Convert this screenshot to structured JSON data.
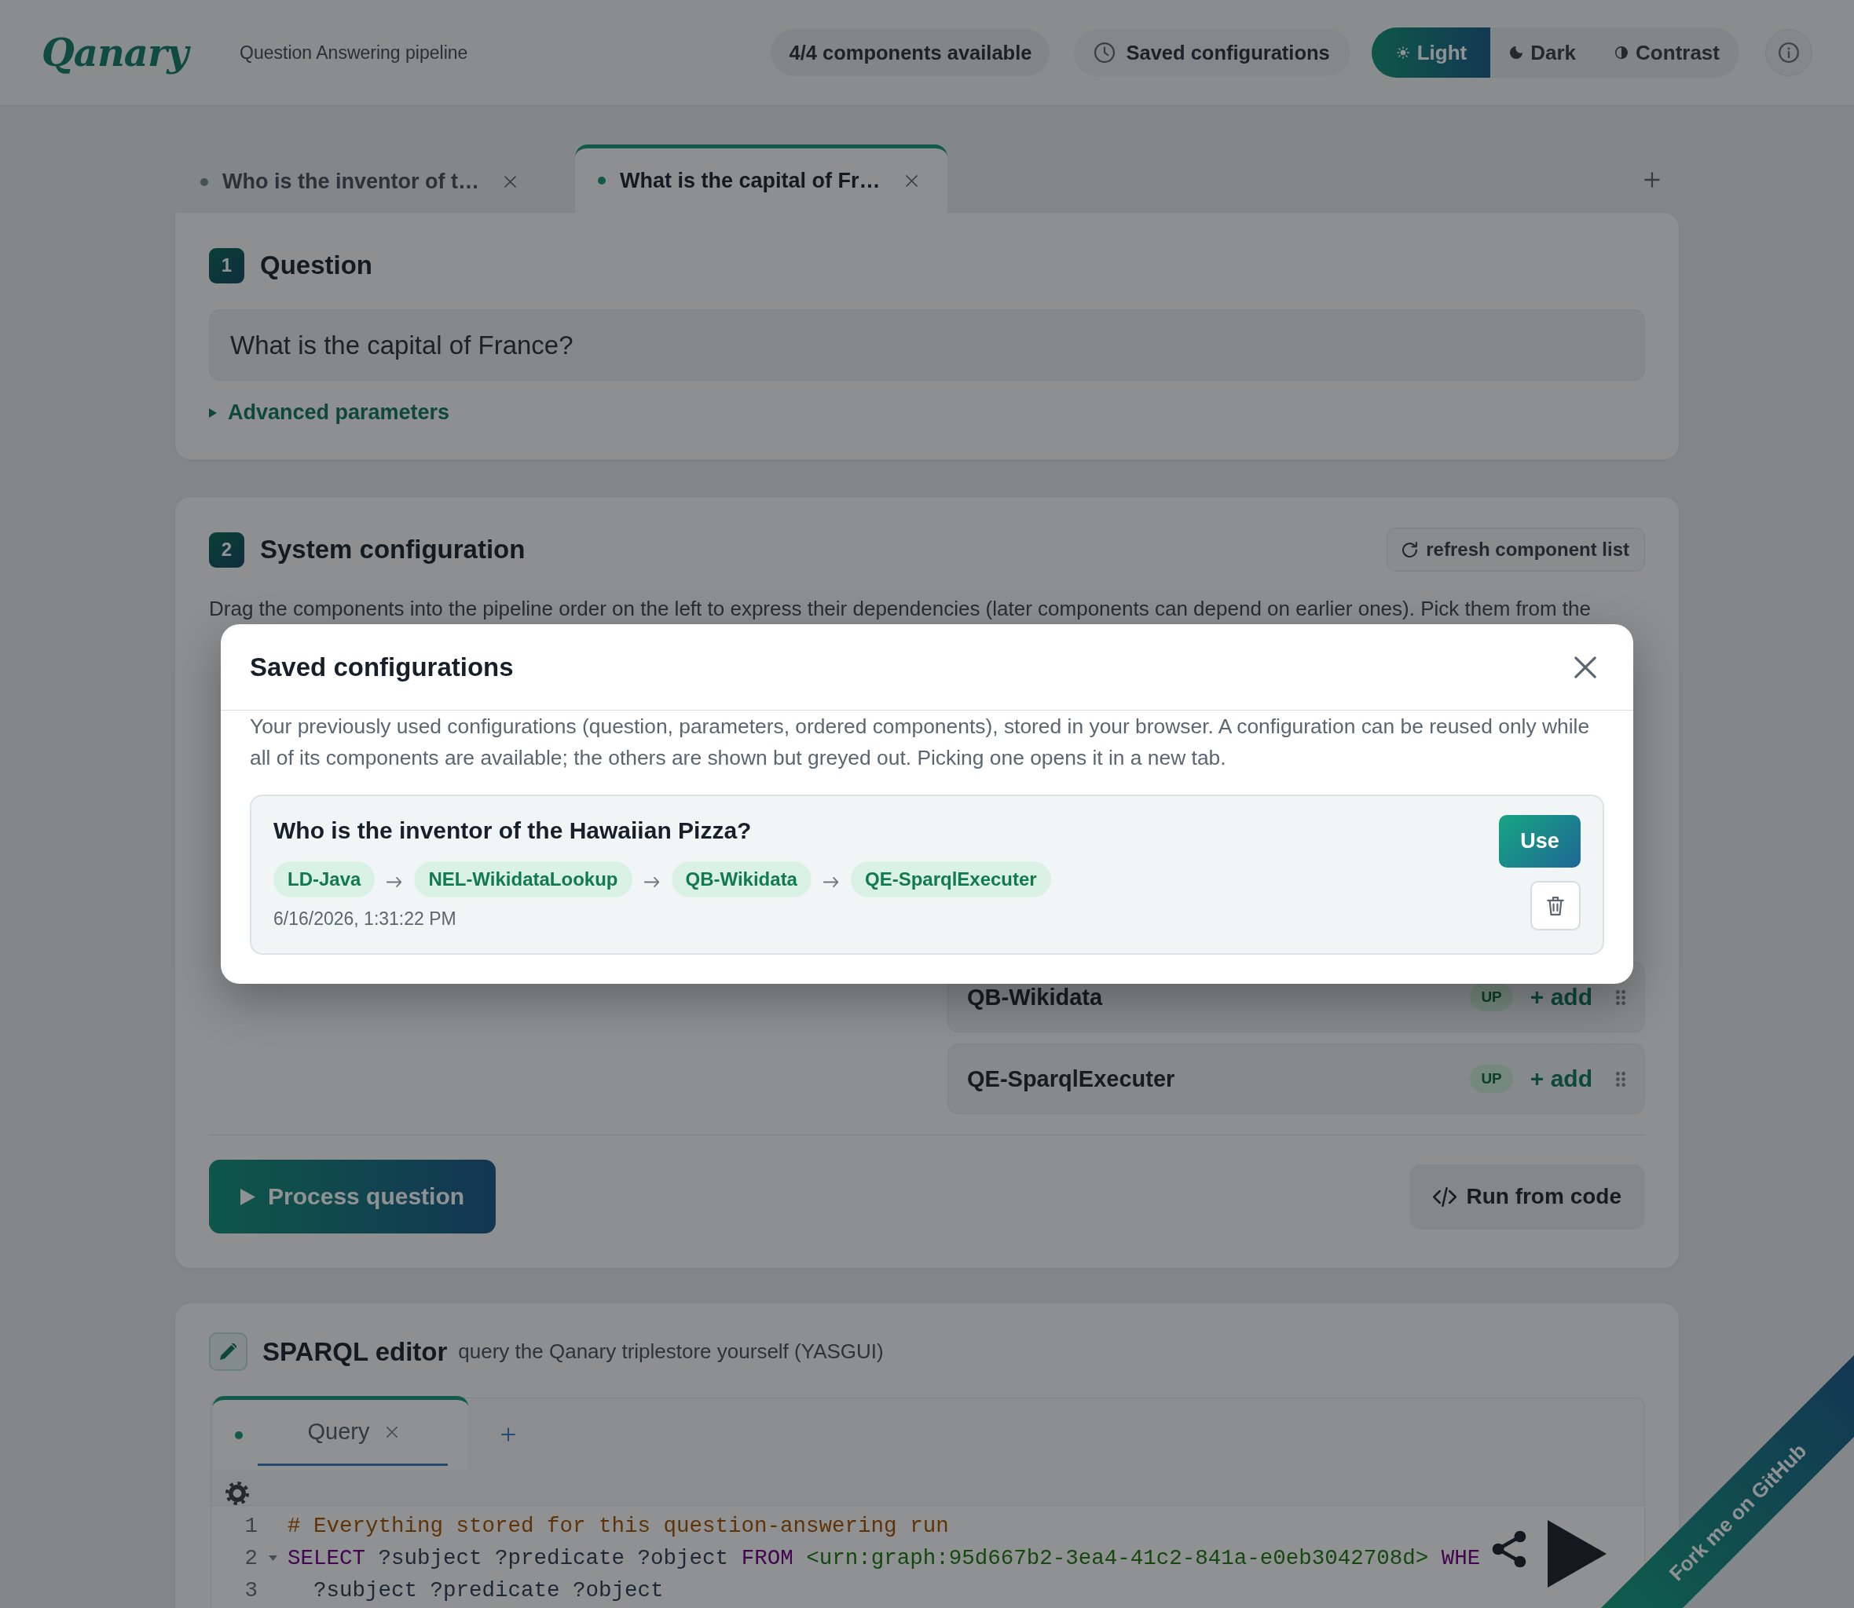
{
  "header": {
    "logo": "Qanary",
    "subtitle": "Question Answering pipeline",
    "availability": "4/4 components available",
    "saved_button": "Saved configurations",
    "theme_options": [
      {
        "kind": "sun",
        "label": "Light",
        "selected": true
      },
      {
        "kind": "moon",
        "label": "Dark",
        "selected": false
      },
      {
        "kind": "contrast",
        "label": "Contrast",
        "selected": false
      }
    ]
  },
  "question_tabs": [
    {
      "label": "Who is the inventor of t…",
      "selected": false
    },
    {
      "label": "What is the capital of Fr…",
      "selected": true
    }
  ],
  "question": {
    "number": "1",
    "title": "Question",
    "value": "What is the capital of France?",
    "advanced": {
      "label": "Advanced parameters",
      "expanded": false
    }
  },
  "system": {
    "number": "2",
    "title": "System configuration",
    "refresh_button": "refresh component list",
    "description": "Drag the components into the pipeline order on the left to express their dependencies (later components can depend on earlier ones). Pick them from the",
    "components": [
      {
        "name": "QB-Wikidata",
        "status": "UP",
        "action": "+ add"
      },
      {
        "name": "QE-SparqlExecuter",
        "status": "UP",
        "action": "+ add"
      }
    ],
    "process_button": "Process question",
    "code_button": "Run from code"
  },
  "sparql": {
    "title": "SPARQL editor",
    "subtitle": "query the Qanary triplestore yourself (YASGUI)",
    "tabs": [
      {
        "label": "Query",
        "selected": true
      }
    ],
    "lines": [
      {
        "number": "1",
        "foldable": false,
        "tokens": [
          {
            "kind": "comment",
            "text": "# Everything stored for this question-answering run"
          }
        ]
      },
      {
        "number": "2",
        "foldable": true,
        "tokens": [
          {
            "kind": "keyword",
            "text": "SELECT"
          },
          {
            "kind": "variable",
            "text": "?subject ?predicate ?object"
          },
          {
            "kind": "keyword",
            "text": "FROM"
          },
          {
            "kind": "iri",
            "text": "<urn:graph:95d667b2-3ea4-41c2-841a-e0eb3042708d>"
          },
          {
            "kind": "keyword",
            "text": "WHE"
          }
        ]
      },
      {
        "number": "3",
        "foldable": false,
        "tokens": [
          {
            "kind": "variable",
            "text": "  ?subject ?predicate ?object"
          }
        ]
      }
    ]
  },
  "ribbon": "Fork me on GitHub",
  "dialog": {
    "title": "Saved configurations",
    "description": "Your previously used configurations (question, parameters, ordered components), stored in your browser. A configuration can be reused only while all of its components are available; the others are shown but greyed out. Picking one opens it in a new tab.",
    "configurations": [
      {
        "question": "Who is the inventor of the Hawaiian Pizza?",
        "components": [
          "LD-Java",
          "NEL-WikidataLookup",
          "QB-Wikidata",
          "QE-SparqlExecuter"
        ],
        "saved_at": "6/16/2026, 1:31:22 PM",
        "use_button": "Use"
      }
    ]
  }
}
